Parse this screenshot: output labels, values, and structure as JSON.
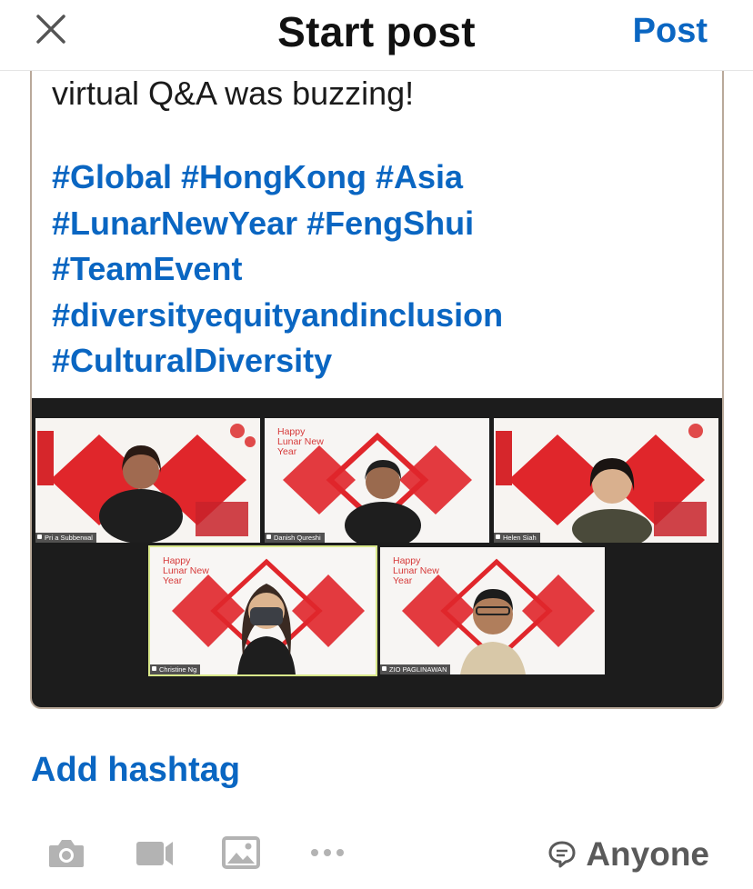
{
  "header": {
    "title": "Start post",
    "post_label": "Post"
  },
  "composer": {
    "text_line": "virtual Q&A was buzzing!",
    "hashtag_lines": [
      "#Global #HongKong #Asia",
      "#LunarNewYear #FengShui",
      "#TeamEvent",
      "#diversityequityandinclusion",
      "#CulturalDiversity"
    ]
  },
  "video_call": {
    "participants": [
      {
        "name": "Pri a Subberwal",
        "greeting": ""
      },
      {
        "name": "Danish Qureshi",
        "greeting": "Happy Lunar New Year"
      },
      {
        "name": "Helen Siah",
        "greeting": ""
      },
      {
        "name": "Christine Ng",
        "greeting": "Happy Lunar New Year"
      },
      {
        "name": "ZIO PAGLINAWAN",
        "greeting": "Happy Lunar New Year"
      }
    ]
  },
  "add_hashtag_label": "Add hashtag",
  "toolbar": {
    "icons": [
      "camera-icon",
      "video-icon",
      "image-icon",
      "more-icon"
    ],
    "visibility_label": "Anyone"
  },
  "colors": {
    "brand_blue": "#0a66c2",
    "festive_red": "#e0262b"
  }
}
